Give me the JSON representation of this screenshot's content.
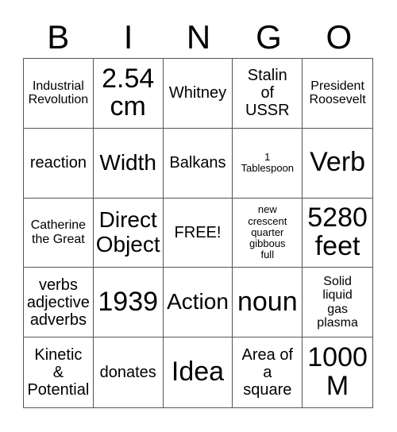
{
  "header": [
    "B",
    "I",
    "N",
    "G",
    "O"
  ],
  "cells": [
    {
      "text": "Industrial\nRevolution",
      "size": "s2"
    },
    {
      "text": "2.54\ncm",
      "size": "s5"
    },
    {
      "text": "Whitney",
      "size": "s3"
    },
    {
      "text": "Stalin\nof\nUSSR",
      "size": "s3"
    },
    {
      "text": "President\nRoosevelt",
      "size": "s2"
    },
    {
      "text": "reaction",
      "size": "s3"
    },
    {
      "text": "Width",
      "size": "s4"
    },
    {
      "text": "Balkans",
      "size": "s3"
    },
    {
      "text": "1\nTablespoon",
      "size": "s1"
    },
    {
      "text": "Verb",
      "size": "s5"
    },
    {
      "text": "Catherine\nthe Great",
      "size": "s2"
    },
    {
      "text": "Direct\nObject",
      "size": "s4"
    },
    {
      "text": "FREE!",
      "size": "s3"
    },
    {
      "text": "new\ncrescent\nquarter\ngibbous\nfull",
      "size": "s1"
    },
    {
      "text": "5280\nfeet",
      "size": "s5"
    },
    {
      "text": "verbs\nadjective\nadverbs",
      "size": "s3"
    },
    {
      "text": "1939",
      "size": "s5"
    },
    {
      "text": "Action",
      "size": "s4"
    },
    {
      "text": "noun",
      "size": "s5"
    },
    {
      "text": "Solid\nliquid\ngas\nplasma",
      "size": "s2"
    },
    {
      "text": "Kinetic\n&\nPotential",
      "size": "s3"
    },
    {
      "text": "donates",
      "size": "s3"
    },
    {
      "text": "Idea",
      "size": "s5"
    },
    {
      "text": "Area of\na\nsquare",
      "size": "s3"
    },
    {
      "text": "1000\nM",
      "size": "s5"
    }
  ]
}
